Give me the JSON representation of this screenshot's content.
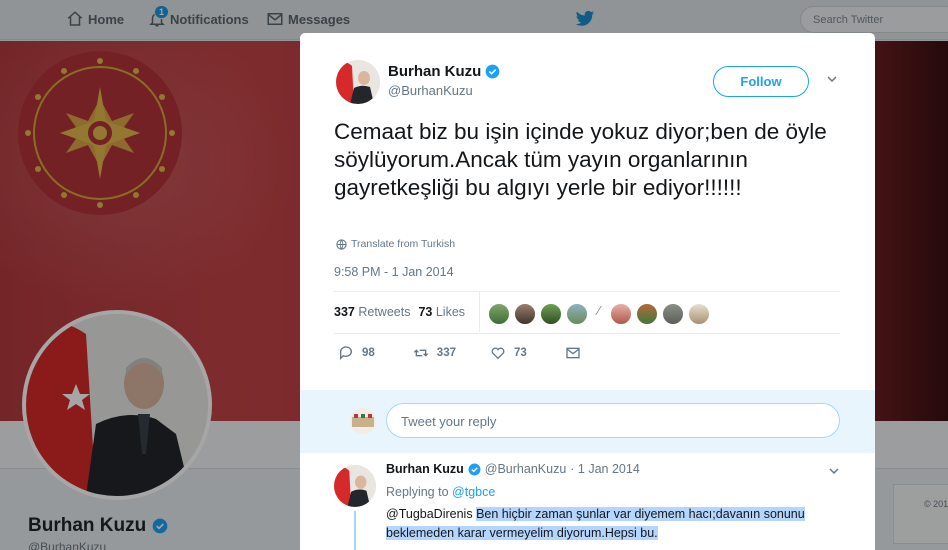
{
  "nav": {
    "home": "Home",
    "notifications": "Notifications",
    "notif_count": "1",
    "messages": "Messages",
    "search_placeholder": "Search Twitter"
  },
  "background_profile": {
    "name": "Burhan Kuzu",
    "handle": "@BurhanKuzu",
    "right_card_text": "© 201"
  },
  "tweet": {
    "author_name": "Burhan Kuzu",
    "author_handle": "@BurhanKuzu",
    "follow_label": "Follow",
    "text": "Cemaat biz bu işin içinde yokuz diyor;ben de öyle söylüyorum.Ancak tüm yayın organlarının gayretkeşliği bu algıyı yerle bir ediyor!!!!!!",
    "translate_label": "Translate from Turkish",
    "timestamp": "9:58 PM - 1 Jan 2014",
    "retweets_count": "337",
    "retweets_label": "Retweets",
    "likes_count": "73",
    "likes_label": "Likes",
    "reply_count": "98",
    "retweet_action_count": "337",
    "like_action_count": "73"
  },
  "reply_box": {
    "placeholder": "Tweet your reply"
  },
  "reply_tweet": {
    "author_name": "Burhan Kuzu",
    "author_handle": "@BurhanKuzu",
    "date": "· 1 Jan 2014",
    "replying_to_label": "Replying to",
    "replying_to_handle": "@tgbce",
    "mention": "@TugbaDirenis",
    "text_line1": "Ben hiçbir zaman şunlar var diyemem hacı;davanın sonunu",
    "text_line2": "beklemeden karar vermeyelim diyorum.Hepsi bu."
  },
  "colors": {
    "accent": "#1da1f2",
    "verified": "#1da1f2",
    "banner_red": "#c24347"
  }
}
